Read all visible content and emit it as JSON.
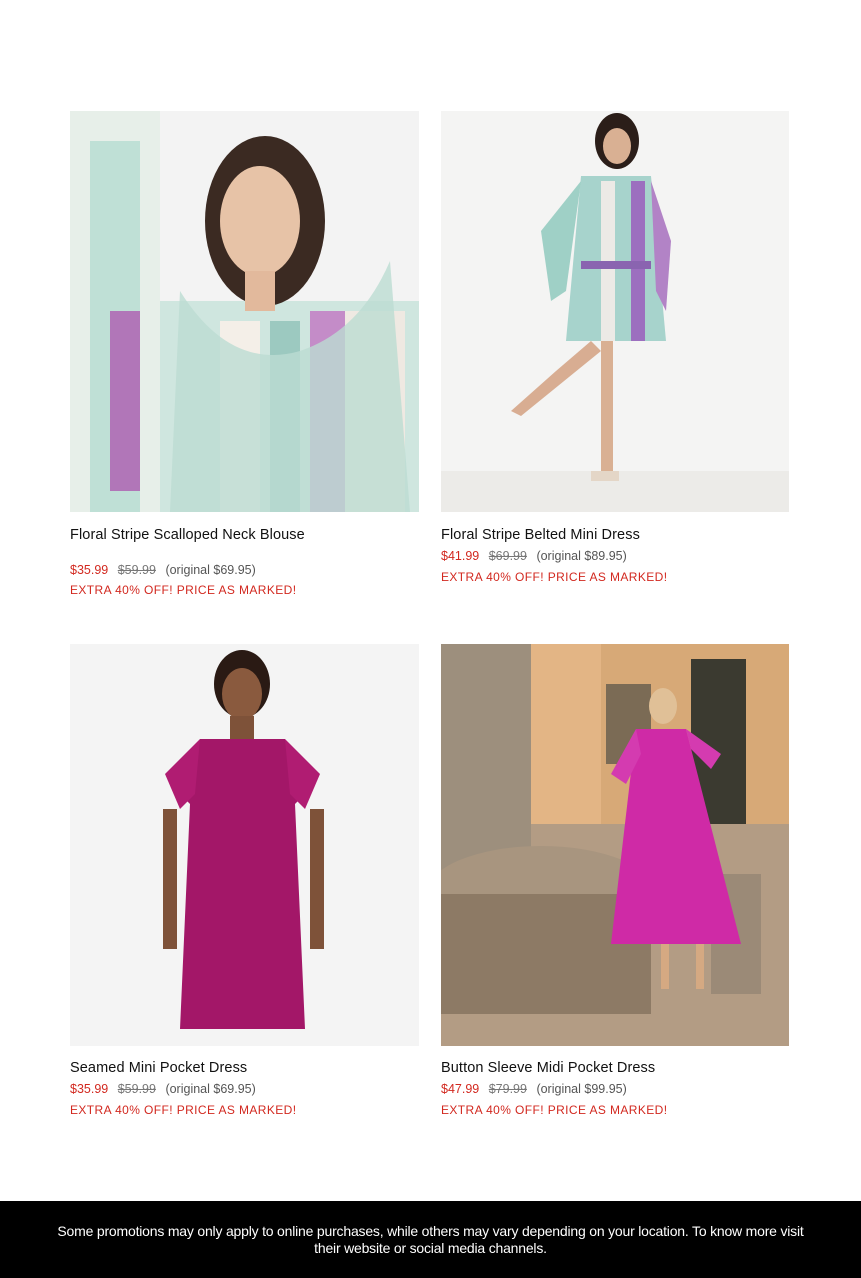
{
  "products": [
    {
      "title": "Floral Stripe Scalloped Neck Blouse",
      "sale_price": "$35.99",
      "was_price": "$59.99",
      "original_price": "(original $69.95)",
      "promo": "EXTRA 40% OFF! PRICE AS MARKED!"
    },
    {
      "title": "Floral Stripe Belted Mini Dress",
      "sale_price": "$41.99",
      "was_price": "$69.99",
      "original_price": "(original $89.95)",
      "promo": "EXTRA 40% OFF! PRICE AS MARKED!"
    },
    {
      "title": "Seamed Mini Pocket Dress",
      "sale_price": "$35.99",
      "was_price": "$59.99",
      "original_price": "(original $69.95)",
      "promo": "EXTRA 40% OFF! PRICE AS MARKED!"
    },
    {
      "title": "Button Sleeve Midi Pocket Dress",
      "sale_price": "$47.99",
      "was_price": "$79.99",
      "original_price": "(original $99.95)",
      "promo": "EXTRA 40% OFF! PRICE AS MARKED!"
    }
  ],
  "footer": {
    "disclaimer": "Some promotions may only apply to online purchases, while others may vary depending on your location. To know more visit their website or social media channels."
  },
  "colors": {
    "sale": "#d2281f",
    "footer_bg": "#000000"
  }
}
